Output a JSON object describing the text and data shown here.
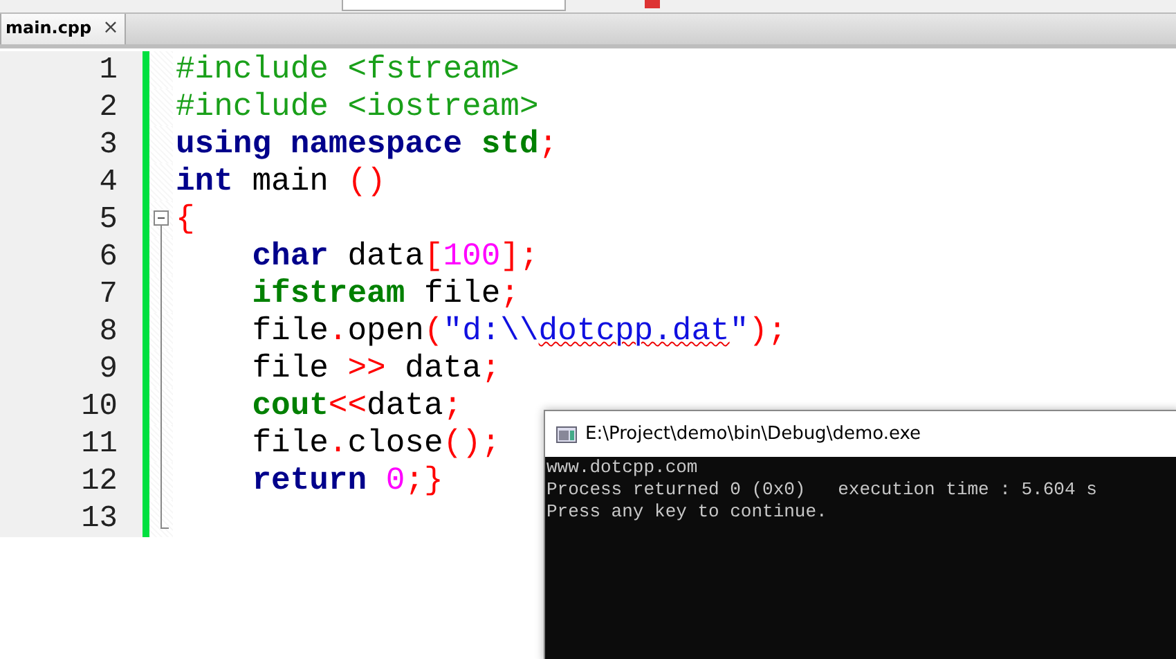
{
  "tabs": [
    {
      "label": "main.cpp",
      "close": "×",
      "selected": true
    }
  ],
  "editor": {
    "lines": [
      {
        "number": "1",
        "modified": true,
        "fold_marker": false,
        "tokens": [
          {
            "t": "#include <fstream>",
            "kind": "pre"
          }
        ]
      },
      {
        "number": "2",
        "modified": true,
        "fold_marker": false,
        "tokens": [
          {
            "t": "#include <iostream>",
            "kind": "pre"
          }
        ]
      },
      {
        "number": "3",
        "modified": true,
        "fold_marker": false,
        "tokens": [
          {
            "t": "using namespace ",
            "kind": "kw"
          },
          {
            "t": "std",
            "kind": "type"
          },
          {
            "t": ";",
            "kind": "op"
          }
        ]
      },
      {
        "number": "4",
        "modified": true,
        "fold_marker": false,
        "tokens": [
          {
            "t": "int",
            "kind": "kw"
          },
          {
            "t": " main ",
            "kind": "plain"
          },
          {
            "t": "()",
            "kind": "op"
          }
        ]
      },
      {
        "number": "5",
        "modified": true,
        "fold_marker": true,
        "tokens": [
          {
            "t": "{",
            "kind": "op"
          }
        ]
      },
      {
        "number": "6",
        "modified": true,
        "fold_marker": false,
        "tokens": [
          {
            "t": "    char",
            "kind": "kw"
          },
          {
            "t": " data",
            "kind": "plain"
          },
          {
            "t": "[",
            "kind": "op"
          },
          {
            "t": "100",
            "kind": "num"
          },
          {
            "t": "];",
            "kind": "op"
          }
        ]
      },
      {
        "number": "7",
        "modified": true,
        "fold_marker": false,
        "tokens": [
          {
            "t": "    ifstream",
            "kind": "type"
          },
          {
            "t": " file",
            "kind": "plain"
          },
          {
            "t": ";",
            "kind": "op"
          }
        ]
      },
      {
        "number": "8",
        "modified": true,
        "fold_marker": false,
        "tokens": [
          {
            "t": "    file",
            "kind": "plain"
          },
          {
            "t": ".",
            "kind": "op"
          },
          {
            "t": "open",
            "kind": "plain"
          },
          {
            "t": "(",
            "kind": "op"
          },
          {
            "t": "\"d:\\\\",
            "kind": "str"
          },
          {
            "t": "dotcpp.dat",
            "kind": "str",
            "misspelled": true
          },
          {
            "t": "\"",
            "kind": "str"
          },
          {
            "t": ");",
            "kind": "op"
          }
        ]
      },
      {
        "number": "9",
        "modified": true,
        "fold_marker": false,
        "tokens": [
          {
            "t": "    file ",
            "kind": "plain"
          },
          {
            "t": ">>",
            "kind": "op"
          },
          {
            "t": " data",
            "kind": "plain"
          },
          {
            "t": ";",
            "kind": "op"
          }
        ]
      },
      {
        "number": "10",
        "modified": true,
        "fold_marker": false,
        "tokens": [
          {
            "t": "    cout",
            "kind": "type"
          },
          {
            "t": "<<",
            "kind": "op"
          },
          {
            "t": "data",
            "kind": "plain"
          },
          {
            "t": ";",
            "kind": "op"
          }
        ]
      },
      {
        "number": "11",
        "modified": true,
        "fold_marker": false,
        "tokens": [
          {
            "t": "    file",
            "kind": "plain"
          },
          {
            "t": ".",
            "kind": "op"
          },
          {
            "t": "close",
            "kind": "plain"
          },
          {
            "t": "();",
            "kind": "op"
          }
        ]
      },
      {
        "number": "12",
        "modified": true,
        "fold_marker": false,
        "tokens": [
          {
            "t": "    return",
            "kind": "kw"
          },
          {
            "t": " 0",
            "kind": "num"
          },
          {
            "t": ";}",
            "kind": "op"
          }
        ]
      },
      {
        "number": "13",
        "modified": true,
        "fold_marker": false
      }
    ]
  },
  "console": {
    "title": "E:\\Project\\demo\\bin\\Debug\\demo.exe",
    "lines": [
      "www.dotcpp.com",
      "Process returned 0 (0x0)   execution time : 5.604 s",
      "Press any key to continue."
    ]
  }
}
